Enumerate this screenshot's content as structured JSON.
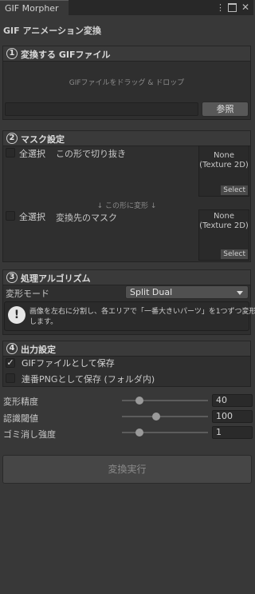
{
  "window": {
    "tab_label": "GIF Morpher",
    "icons": [
      "more-icon",
      "maximize-icon",
      "close-icon"
    ]
  },
  "page_title": "GIF アニメーション変換",
  "section1": {
    "number": "1",
    "title": "変換する GIFファイル",
    "drop_hint": "GIFファイルをドラッグ & ドロップ",
    "path_value": "",
    "browse_label": "参照"
  },
  "section2": {
    "number": "2",
    "title": "マスク設定",
    "select_all_label": "全選択",
    "source_mask_label": "この形で切り抜き",
    "arrow_hint": "↓  この形に変形  ↓",
    "target_mask_label": "変換先のマスク",
    "texture_none": "None",
    "texture_type": "(Texture 2D)",
    "select_label": "Select"
  },
  "section3": {
    "number": "3",
    "title": "処理アルゴリズム",
    "mode_label": "変形モード",
    "mode_value": "Split Dual",
    "help_line1": "画像を左右に分割し、各エリアで「一番大きいパーツ」を1つずつ変形",
    "help_line2": "します。"
  },
  "section4": {
    "number": "4",
    "title": "出力設定",
    "gif_label": "GIFファイルとして保存",
    "gif_checked": true,
    "png_label": "連番PNGとして保存 (フォルダ内)",
    "png_checked": false
  },
  "params": [
    {
      "label": "変形精度",
      "value": "40",
      "fraction": 0.2
    },
    {
      "label": "認識閾値",
      "value": "100",
      "fraction": 0.4
    },
    {
      "label": "ゴミ消し強度",
      "value": "1",
      "fraction": 0.2
    }
  ],
  "convert_label": "変換実行"
}
